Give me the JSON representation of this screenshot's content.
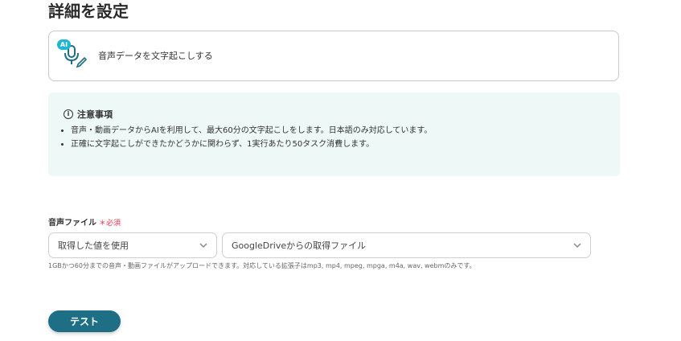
{
  "page": {
    "title": "詳細を設定"
  },
  "action": {
    "badge": "AI",
    "label": "音声データを文字起こしする",
    "icon": "microphone-pen-icon"
  },
  "notice": {
    "title": "注意事項",
    "items": [
      "音声・動画データからAIを利用して、最大60分の文字起こしをします。日本語のみ対応しています。",
      "正確に文字起こしができたかどうかに関わらず、1実行あたり50タスク消費します。"
    ]
  },
  "audio_field": {
    "label": "音声ファイル",
    "required_mark": "＊",
    "required_text": "必須",
    "source_select": {
      "value": "取得した値を使用"
    },
    "value_select": {
      "value": "GoogleDriveからの取得ファイル"
    },
    "help": "1GBかつ60分までの音声・動画ファイルがアップロードできます。対応している拡張子はmp3, mp4, mpeg, mpga, m4a, wav, webmのみです。"
  },
  "test_button": {
    "label": "テスト"
  },
  "colors": {
    "accent": "#1e6f86",
    "required": "#e0344a",
    "notice_bg": "#eef8f7",
    "badge": "#1fb6d4"
  }
}
